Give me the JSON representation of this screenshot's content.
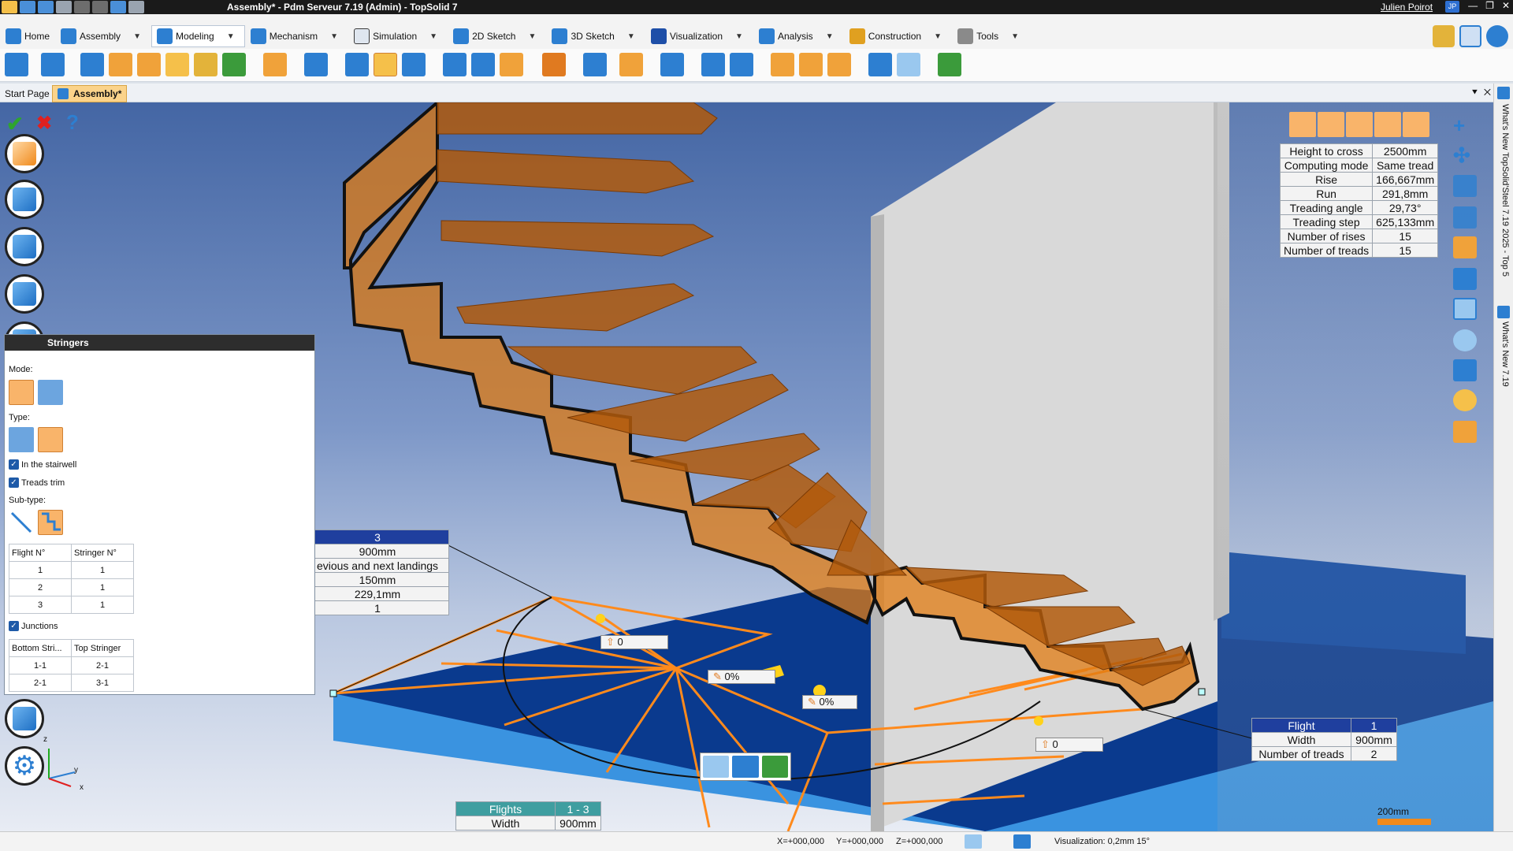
{
  "window": {
    "title": "Assembly* - Pdm Serveur 7.19 (Admin) - TopSolid 7",
    "user": "Julien Poirot",
    "user_initials": "JP"
  },
  "ribbon_tabs": [
    {
      "label": "Home",
      "color": "#2d7fd1"
    },
    {
      "label": "Assembly",
      "color": "#2d7fd1"
    },
    {
      "label": "Modeling",
      "color": "#2d7fd1",
      "active": true
    },
    {
      "label": "Mechanism",
      "color": "#2d7fd1"
    },
    {
      "label": "Simulation",
      "color": "#3a3a3a"
    },
    {
      "label": "2D Sketch",
      "color": "#2d7fd1"
    },
    {
      "label": "3D Sketch",
      "color": "#2d7fd1"
    },
    {
      "label": "Visualization",
      "color": "#1e4fa8"
    },
    {
      "label": "Analysis",
      "color": "#2d7fd1"
    },
    {
      "label": "Construction",
      "color": "#e0a020"
    },
    {
      "label": "Tools",
      "color": "#555555"
    }
  ],
  "doc_tabs": {
    "start": "Start Page",
    "active": "Assembly*"
  },
  "left_tools": {
    "validate": "✔",
    "cancel": "✖",
    "help": "?"
  },
  "stringers_panel": {
    "title": "Stringers",
    "mode_label": "Mode:",
    "type_label": "Type:",
    "in_stairwell": "In the stairwell",
    "treads_trim": "Treads trim",
    "subtype_label": "Sub-type:",
    "flight_table": {
      "headers": [
        "Flight N°",
        "Stringer N°"
      ],
      "rows": [
        [
          "1",
          "1"
        ],
        [
          "2",
          "1"
        ],
        [
          "3",
          "1"
        ]
      ]
    },
    "junctions": "Junctions",
    "junction_table": {
      "headers": [
        "Bottom Stri...",
        "Top Stringer"
      ],
      "rows": [
        [
          "1-1",
          "2-1"
        ],
        [
          "2-1",
          "3-1"
        ]
      ]
    }
  },
  "stair_props": {
    "rows": [
      [
        "Height to cross",
        "2500mm"
      ],
      [
        "Computing mode",
        "Same tread"
      ],
      [
        "Rise",
        "166,667mm"
      ],
      [
        "Run",
        "291,8mm"
      ],
      [
        "Treading angle",
        "29,73°"
      ],
      [
        "Treading step",
        "625,133mm"
      ],
      [
        "Number of rises",
        "15"
      ],
      [
        "Number of treads",
        "15"
      ]
    ]
  },
  "landing_table": {
    "header": "3",
    "rows": [
      "900mm",
      "evious and next landings",
      "150mm",
      "229,1mm",
      "1"
    ]
  },
  "flight_table": {
    "header_label": "Flight",
    "header_value": "1",
    "rows": [
      [
        "Width",
        "900mm"
      ],
      [
        "Number of treads",
        "2"
      ]
    ]
  },
  "flights_table": {
    "header_label": "Flights",
    "header_value": "1 - 3",
    "rows": [
      [
        "Width",
        "900mm"
      ]
    ]
  },
  "tags": {
    "t1": "0",
    "t2": "0%",
    "t3": "0%",
    "t4": "0"
  },
  "scale": "200mm",
  "side_labels": {
    "a": "What's New TopSolid'Steel 7.19 2025 - Top 5",
    "b": "What's New 7.19"
  },
  "status": {
    "x": "X=+000,000",
    "y": "Y=+000,000",
    "z": "Z=+000,000",
    "visualization": "Visualization: 0,2mm 15°"
  },
  "axes": {
    "x": "x",
    "y": "y",
    "z": "z"
  }
}
